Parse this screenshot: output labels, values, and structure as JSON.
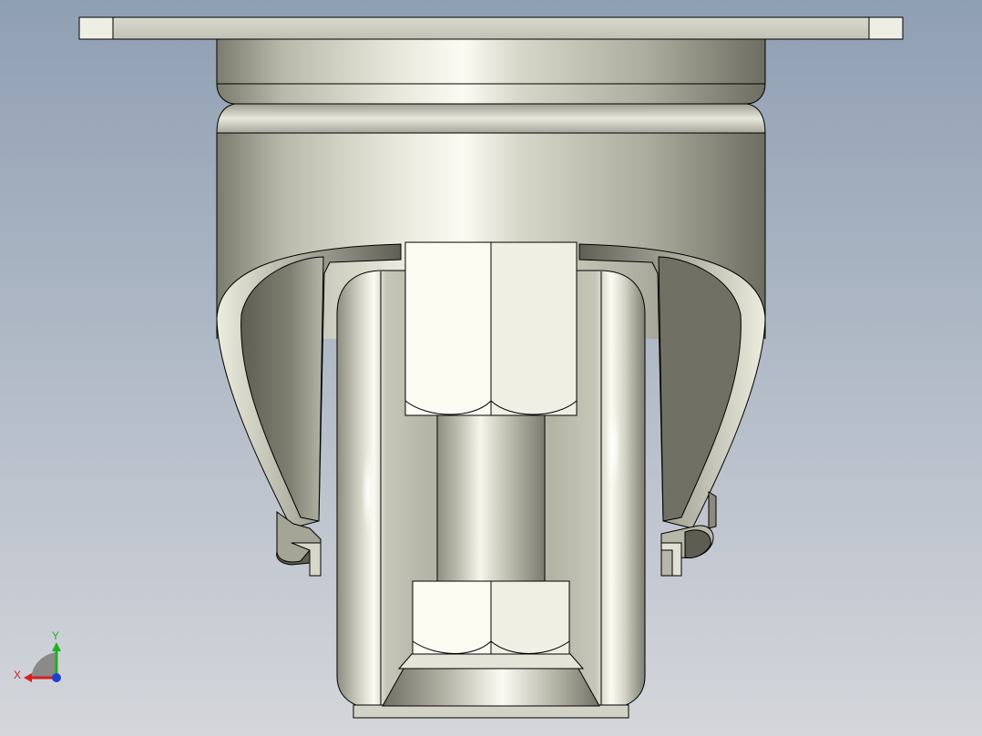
{
  "viewport": {
    "background_top": "#8f9fb3",
    "background_bottom": "#d4d6db"
  },
  "model": {
    "name": "caster-wheel-assembly",
    "view": "front",
    "metal_light": "#f1f1e7",
    "metal_mid": "#c8c8bb",
    "metal_dark": "#6f6f63",
    "metal_pale": "#fbfbf4",
    "edge_color": "#000000"
  },
  "triad": {
    "x_label": "X",
    "y_label": "Y",
    "x_color": "#d52020",
    "y_color": "#20b020",
    "z_color": "#2040d0"
  }
}
